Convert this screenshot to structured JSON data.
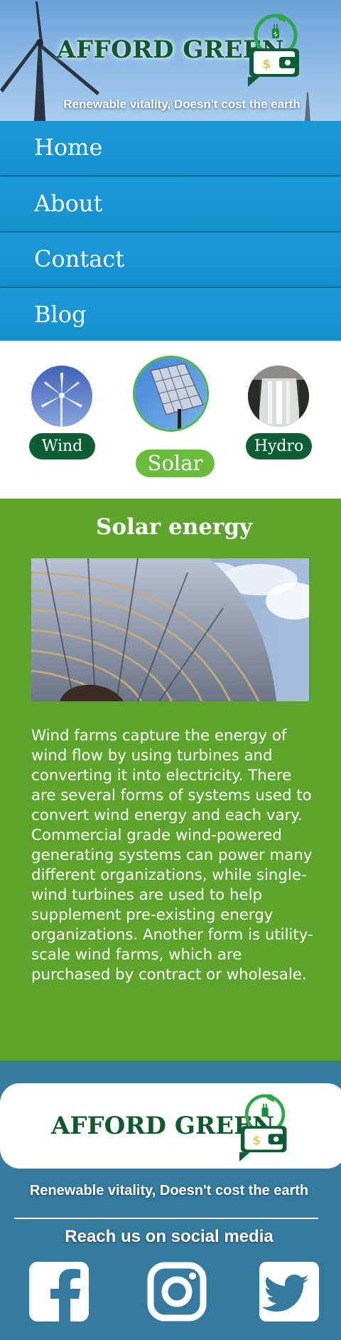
{
  "header": {
    "brand": "AFFORD GREEN",
    "tagline": "Renewable vitality, Doesn't cost the earth",
    "logo_icon": "plug-wallet-icon",
    "background_icon": "wind-turbine-icon"
  },
  "nav": {
    "items": [
      {
        "label": "Home"
      },
      {
        "label": "About"
      },
      {
        "label": "Contact"
      },
      {
        "label": "Blog"
      }
    ]
  },
  "energy_selector": {
    "options": [
      {
        "label": "Wind",
        "selected": false,
        "icon": "wind-turbine-thumbnail"
      },
      {
        "label": "Solar",
        "selected": true,
        "icon": "solar-panel-thumbnail"
      },
      {
        "label": "Hydro",
        "selected": false,
        "icon": "waterfall-thumbnail"
      }
    ]
  },
  "content": {
    "title": "Solar energy",
    "image": "solar-collector-array-photo",
    "body": "Wind farms capture the energy of wind flow by using turbines and converting it into electricity. There are several forms of systems used to convert wind energy and each vary. Commercial grade wind-powered generating systems can power many different organizations, while single-wind turbines are used to help supplement pre-existing energy organizations. Another form is utility-scale wind farms, which are purchased by contract or wholesale."
  },
  "footer": {
    "brand": "AFFORD GREEN",
    "tagline": "Renewable vitality, Doesn't cost the earth",
    "social_title": "Reach us on social media",
    "social_links": [
      {
        "icon": "facebook-icon"
      },
      {
        "icon": "instagram-icon"
      },
      {
        "icon": "twitter-icon"
      }
    ]
  },
  "colors": {
    "nav_blue": "#1793d2",
    "content_green": "#5da42d",
    "footer_blue": "#357a9f",
    "brand_green": "#0f5a2a",
    "pill_dark_green": "#0d5e35",
    "pill_selected_green": "#6abd3c"
  }
}
